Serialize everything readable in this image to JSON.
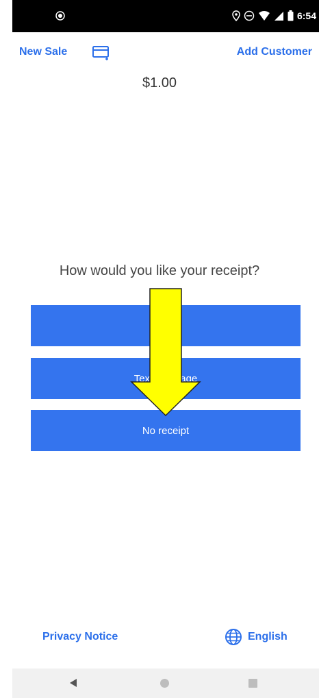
{
  "status_bar": {
    "time": "6:54",
    "icons": [
      "location-icon",
      "do-not-disturb-icon",
      "wifi-icon",
      "signal-icon",
      "battery-icon"
    ]
  },
  "header": {
    "new_sale_label": "New Sale",
    "add_customer_label": "Add Customer"
  },
  "sale": {
    "total": "$1.00"
  },
  "receipt": {
    "question": "How would you like your receipt?",
    "options": [
      {
        "label": ""
      },
      {
        "label": "Text message"
      },
      {
        "label": "No receipt"
      }
    ]
  },
  "footer": {
    "privacy_label": "Privacy Notice",
    "language_label": "English"
  },
  "colors": {
    "accent": "#2b6fea",
    "button": "#3474ee",
    "arrow_fill": "#ffff00"
  }
}
